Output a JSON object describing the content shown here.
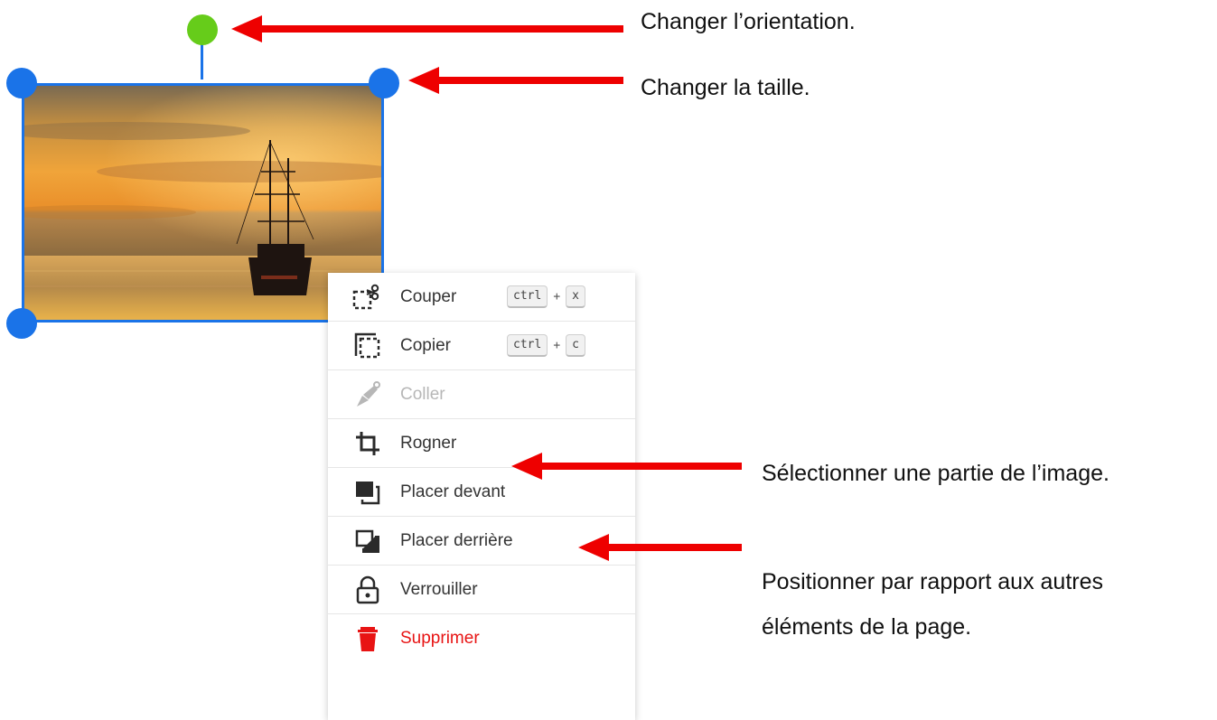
{
  "menu": {
    "items": [
      {
        "label": "Couper",
        "icon": "cut-icon",
        "shortcut": [
          "ctrl",
          "+",
          "x"
        ],
        "state": "enabled"
      },
      {
        "label": "Copier",
        "icon": "copy-icon",
        "shortcut": [
          "ctrl",
          "+",
          "c"
        ],
        "state": "enabled"
      },
      {
        "label": "Coller",
        "icon": "paste-brush-icon",
        "state": "disabled"
      },
      {
        "label": "Rogner",
        "icon": "crop-icon",
        "state": "enabled"
      },
      {
        "label": "Placer devant",
        "icon": "bring-to-front-icon",
        "state": "enabled"
      },
      {
        "label": "Placer derrière",
        "icon": "send-to-back-icon",
        "state": "enabled"
      },
      {
        "label": "Verrouiller",
        "icon": "lock-icon",
        "state": "enabled"
      },
      {
        "label": "Supprimer",
        "icon": "trash-icon",
        "state": "danger"
      }
    ]
  },
  "annotations": {
    "rotate": "Changer l’orientation.",
    "resize": "Changer la taille.",
    "crop": "Sélectionner une partie de l’image.",
    "position_line1": "Positionner par rapport aux autres",
    "position_line2": "éléments de la page."
  },
  "colors": {
    "selection": "#1a73e8",
    "rotate_handle": "#66cc1a",
    "arrow": "#ee0000",
    "danger": "#e81414",
    "disabled": "#b7b7b7"
  }
}
